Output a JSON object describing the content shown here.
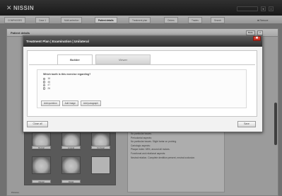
{
  "app": {
    "brand": "NISSIN",
    "user_menu": "",
    "tabs": [
      "COMPASSES",
      "Case 1",
      "Multi-selection",
      "Patient details",
      "Treatment plan",
      "Orders",
      "Trades",
      "Search"
    ],
    "close_label": "✖ Remove"
  },
  "panel": {
    "title": "Patient details",
    "btn_data": "Data",
    "btn_help": "?"
  },
  "teeth": {
    "labels": [
      "Buccal",
      "Lingual",
      "Occlusal",
      "Mesial",
      "Distal",
      ""
    ]
  },
  "notes": {
    "lines": [
      "No particular issues.",
      "Periodontal aspects:",
      "No particular issues. Slight tartar on probing.",
      "Cariologic aspects:",
      "Plaque index: 65%, around all molars.",
      "Functional and relational aspects:",
      "Neutral relation. Complete dentition present, neutral occlusion."
    ]
  },
  "footer_note": "Pictures",
  "modal": {
    "title": "Treatment Plan | Examination | Unilateral",
    "close": "✖",
    "tabs": {
      "builder": "Builder",
      "viewer": "Viewer"
    },
    "question": "Which tooth is this exercise regarding?",
    "options": [
      "16",
      "46",
      "47",
      "26"
    ],
    "buttons": {
      "add_question": "Add question",
      "add_image": "Add image",
      "add_paragraph": "Add paragraph"
    },
    "footer": {
      "close_all": "Close all",
      "save": "Save"
    }
  }
}
